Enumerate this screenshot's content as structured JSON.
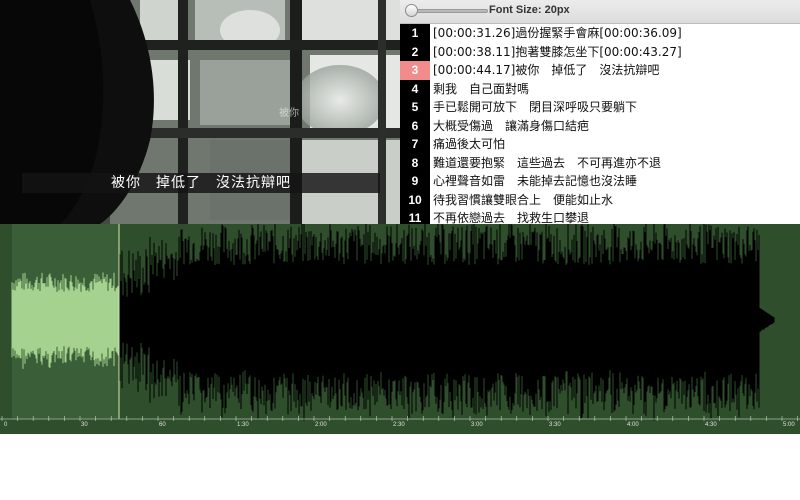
{
  "video": {
    "subtitle": "被你　掉低了　沒法抗辯吧",
    "watermark": "被你"
  },
  "toolbar": {
    "font_size_label": "Font Size: 20px"
  },
  "lines": [
    {
      "num": "1",
      "text": "[00:00:31.26]過份握緊手會麻[00:00:36.09]",
      "active": false
    },
    {
      "num": "2",
      "text": "[00:00:38.11]抱著雙膝怎坐下[00:00:43.27]",
      "active": false
    },
    {
      "num": "3",
      "text": "[00:00:44.17]被你　掉低了　沒法抗辯吧",
      "active": true
    },
    {
      "num": "4",
      "text": "剩我　自己面對嗎",
      "active": false
    },
    {
      "num": "5",
      "text": "手已鬆開可放下　閉目深呼吸只要躺下",
      "active": false
    },
    {
      "num": "6",
      "text": "大概受傷過　讓滿身傷口結疤",
      "active": false
    },
    {
      "num": "7",
      "text": "痛過後太可怕",
      "active": false
    },
    {
      "num": "8",
      "text": "難道還要抱緊　這些過去　不可再進亦不退",
      "active": false
    },
    {
      "num": "9",
      "text": "心裡聲音如雷　未能掉去記憶也沒法睡",
      "active": false
    },
    {
      "num": "10",
      "text": "待我習慣讓雙眼合上　便能如止水",
      "active": false
    },
    {
      "num": "11",
      "text": "不再依戀過去　找救生口攀退",
      "active": false
    }
  ],
  "timeline": {
    "ticks": [
      "0",
      "30",
      "60",
      "1:30",
      "2:00",
      "2:30",
      "3:00",
      "3:30",
      "4:00",
      "4:30",
      "5:00"
    ]
  },
  "colors": {
    "waveform_bg": "#2f4f2c",
    "waveform_selected": "#a6d28f",
    "waveform_main": "#000000",
    "active_line_highlight": "#f08c8c"
  }
}
